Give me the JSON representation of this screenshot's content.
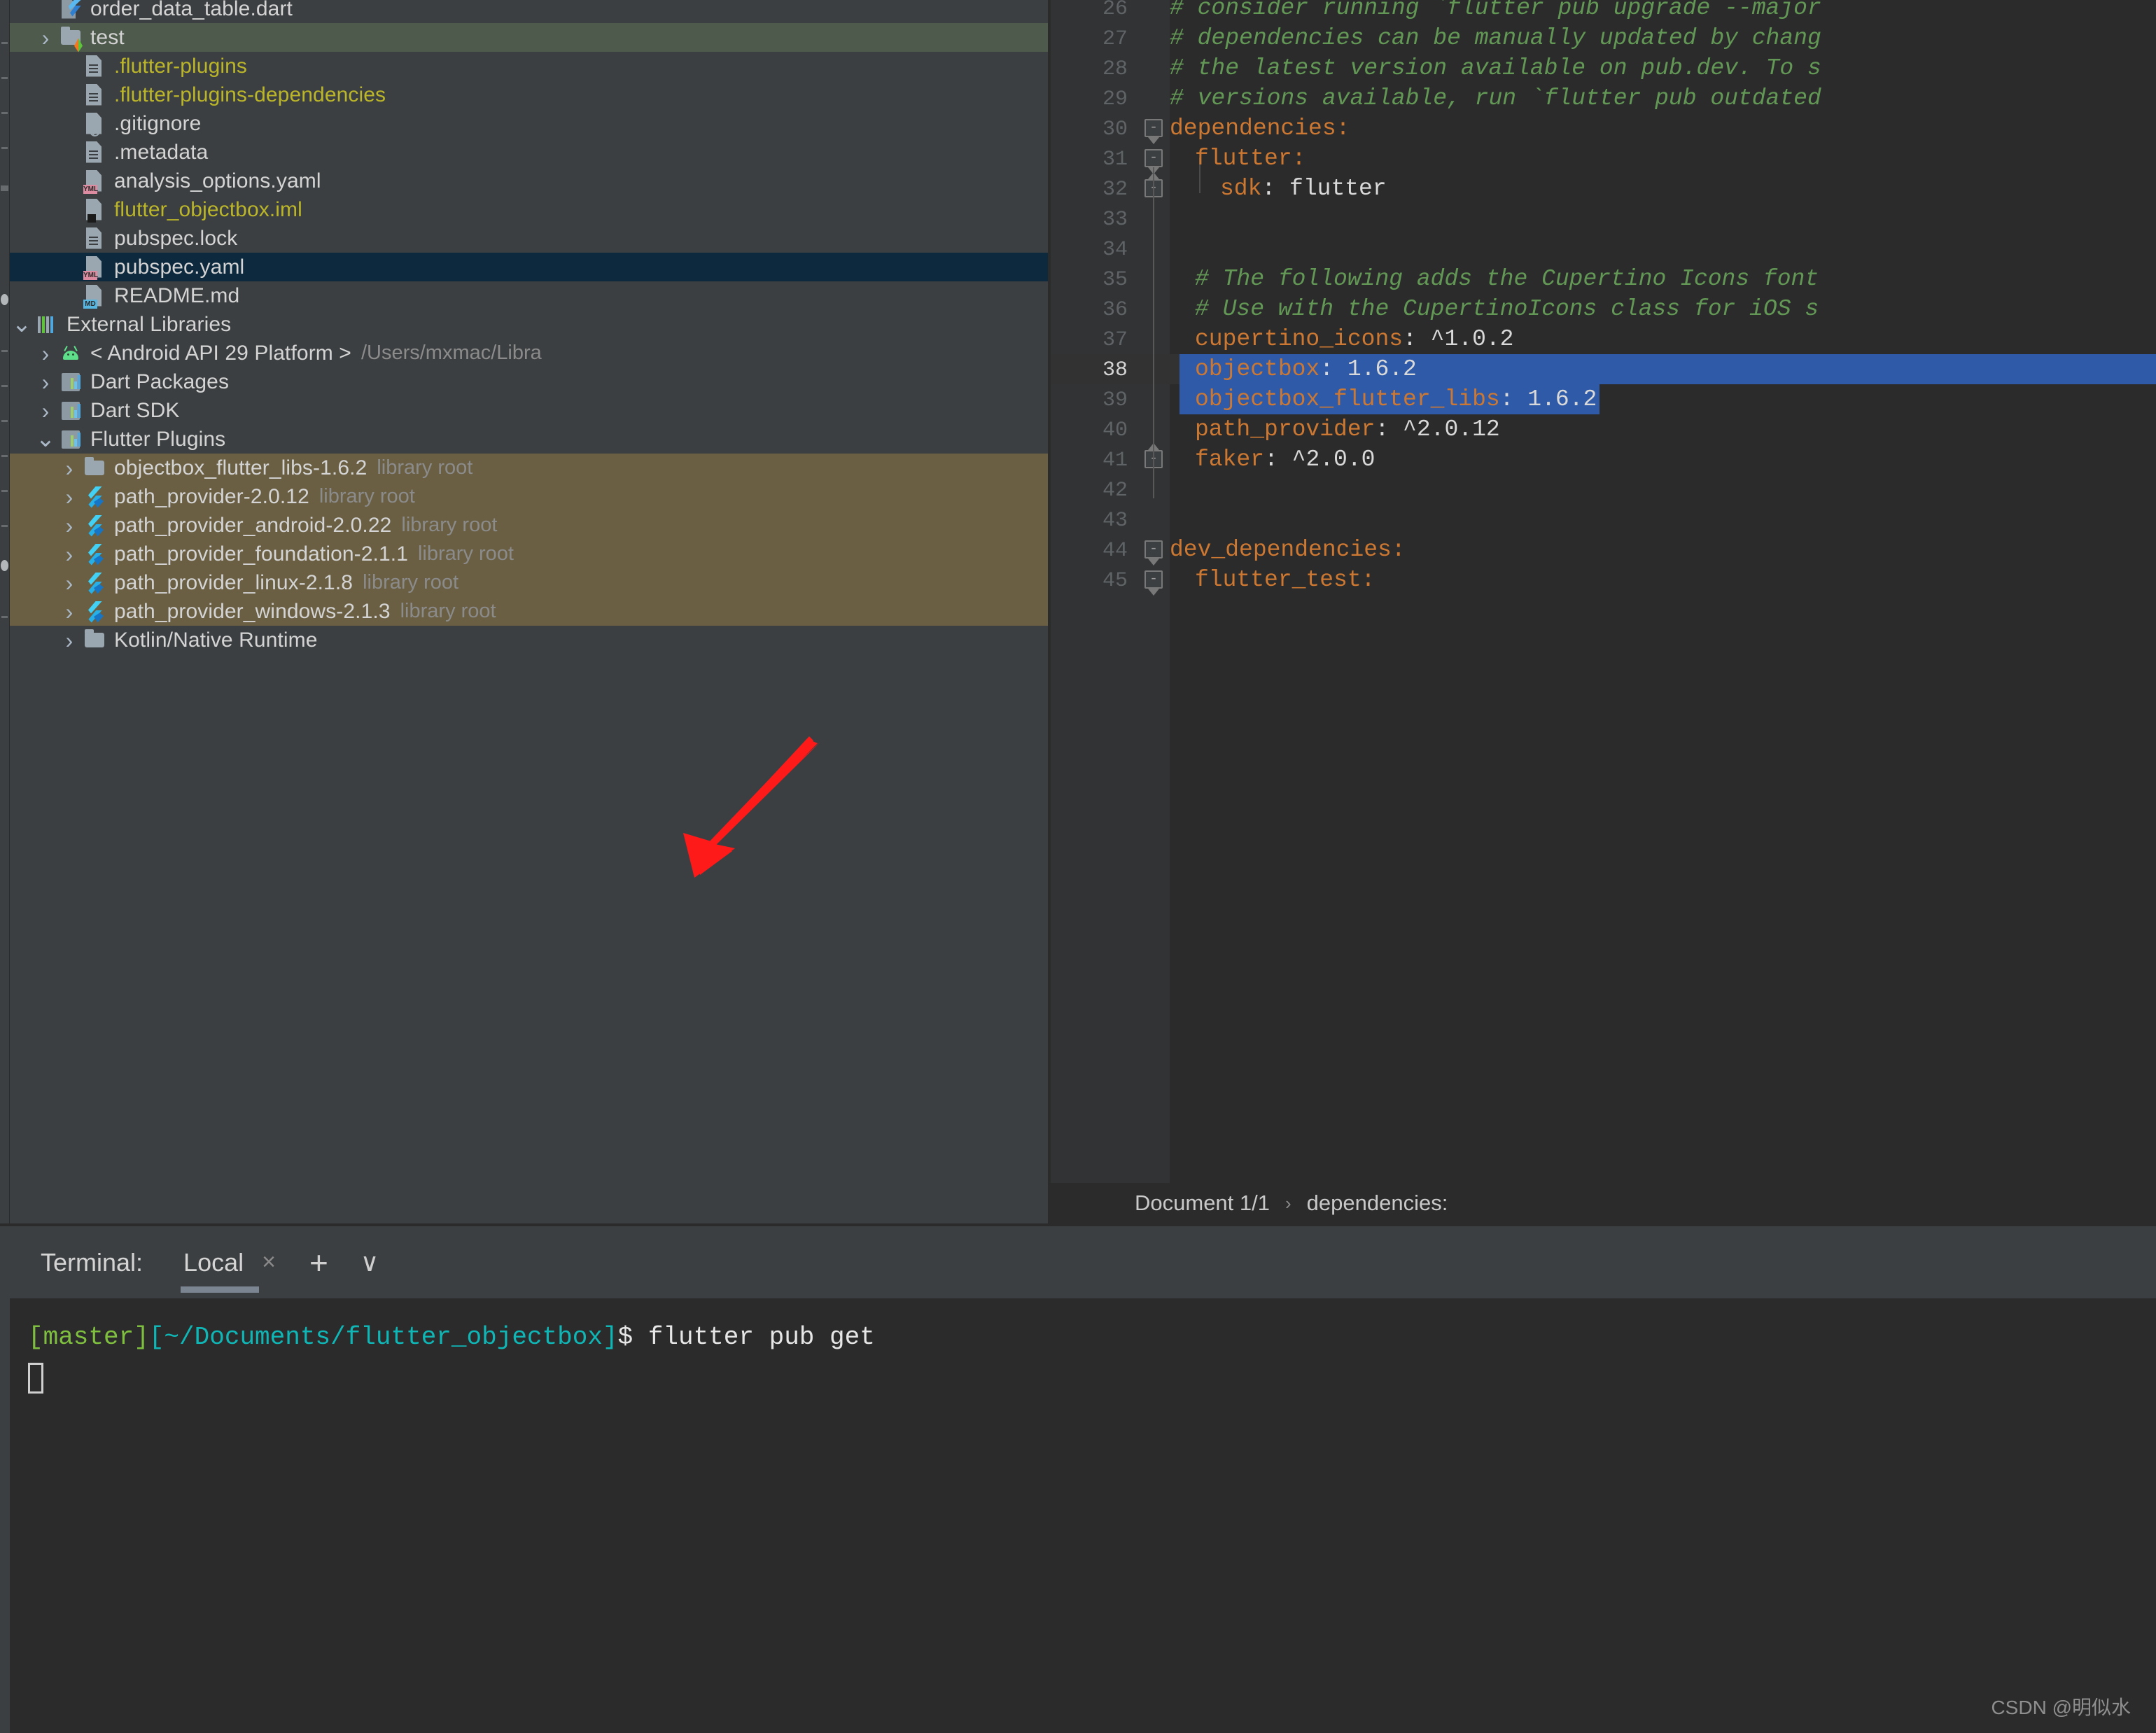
{
  "colors": {
    "panel_bg": "#3c3f41",
    "editor_bg": "#2b2b2b",
    "gutter_bg": "#313335",
    "selection_blue": "#2f5aa8",
    "row_selected_green": "#4e5a4c",
    "row_selected_blue": "#0d293e",
    "row_highlight_tan": "#6a5f43",
    "comment_green": "#629755",
    "keyword_orange": "#cc7832",
    "string_white": "#d9d9d9",
    "yaml_yellow": "#bbb529",
    "arrow_red": "#ff1a1a"
  },
  "project_tree": {
    "rows": [
      {
        "indent": 1,
        "chevron": "",
        "icon": "dart-file-icon",
        "label": "order_data_table.dart",
        "label_color": "white",
        "sub": "",
        "state": "clipped-top"
      },
      {
        "indent": 1,
        "chevron": ">",
        "icon": "folder-flutter-icon",
        "label": "test",
        "label_color": "white",
        "sub": "",
        "state": "selected-green"
      },
      {
        "indent": 2,
        "chevron": "",
        "icon": "file-icon",
        "label": ".flutter-plugins",
        "label_color": "yellow",
        "sub": "",
        "state": ""
      },
      {
        "indent": 2,
        "chevron": "",
        "icon": "file-icon",
        "label": ".flutter-plugins-dependencies",
        "label_color": "yellow",
        "sub": "",
        "state": ""
      },
      {
        "indent": 2,
        "chevron": "",
        "icon": "gitignore-icon",
        "label": ".gitignore",
        "label_color": "white",
        "sub": "",
        "state": ""
      },
      {
        "indent": 2,
        "chevron": "",
        "icon": "file-icon",
        "label": ".metadata",
        "label_color": "white",
        "sub": "",
        "state": ""
      },
      {
        "indent": 2,
        "chevron": "",
        "icon": "yaml-file-icon",
        "label": "analysis_options.yaml",
        "label_color": "white",
        "sub": "",
        "state": ""
      },
      {
        "indent": 2,
        "chevron": "",
        "icon": "iml-file-icon",
        "label": "flutter_objectbox.iml",
        "label_color": "yellow",
        "sub": "",
        "state": ""
      },
      {
        "indent": 2,
        "chevron": "",
        "icon": "file-icon",
        "label": "pubspec.lock",
        "label_color": "white",
        "sub": "",
        "state": ""
      },
      {
        "indent": 2,
        "chevron": "",
        "icon": "yaml-file-icon",
        "label": "pubspec.yaml",
        "label_color": "white",
        "sub": "",
        "state": "selected-blue"
      },
      {
        "indent": 2,
        "chevron": "",
        "icon": "markdown-file-icon",
        "label": "README.md",
        "label_color": "white",
        "sub": "",
        "state": ""
      },
      {
        "indent": 0,
        "chevron": "v",
        "icon": "external-libraries-icon",
        "label": "External Libraries",
        "label_color": "white",
        "sub": "",
        "state": ""
      },
      {
        "indent": 1,
        "chevron": ">",
        "icon": "android-icon",
        "label": "< Android API 29 Platform >",
        "label_color": "white",
        "sub": "/Users/mxmac/Libra",
        "state": ""
      },
      {
        "indent": 1,
        "chevron": ">",
        "icon": "dart-package-icon",
        "label": "Dart Packages",
        "label_color": "white",
        "sub": "",
        "state": ""
      },
      {
        "indent": 1,
        "chevron": ">",
        "icon": "dart-package-icon",
        "label": "Dart SDK",
        "label_color": "white",
        "sub": "",
        "state": ""
      },
      {
        "indent": 1,
        "chevron": "v",
        "icon": "dart-package-icon",
        "label": "Flutter Plugins",
        "label_color": "white",
        "sub": "",
        "state": ""
      },
      {
        "indent": 2,
        "chevron": ">",
        "icon": "folder-icon",
        "label": "objectbox_flutter_libs-1.6.2",
        "label_color": "white",
        "sub": "library root",
        "state": "highlight-tan"
      },
      {
        "indent": 2,
        "chevron": ">",
        "icon": "flutter-icon",
        "label": "path_provider-2.0.12",
        "label_color": "white",
        "sub": "library root",
        "state": "highlight-tan"
      },
      {
        "indent": 2,
        "chevron": ">",
        "icon": "flutter-icon",
        "label": "path_provider_android-2.0.22",
        "label_color": "white",
        "sub": "library root",
        "state": "highlight-tan"
      },
      {
        "indent": 2,
        "chevron": ">",
        "icon": "flutter-icon",
        "label": "path_provider_foundation-2.1.1",
        "label_color": "white",
        "sub": "library root",
        "state": "highlight-tan"
      },
      {
        "indent": 2,
        "chevron": ">",
        "icon": "flutter-icon",
        "label": "path_provider_linux-2.1.8",
        "label_color": "white",
        "sub": "library root",
        "state": "highlight-tan"
      },
      {
        "indent": 2,
        "chevron": ">",
        "icon": "flutter-icon",
        "label": "path_provider_windows-2.1.3",
        "label_color": "white",
        "sub": "library root",
        "state": "highlight-tan"
      },
      {
        "indent": 2,
        "chevron": ">",
        "icon": "folder-icon",
        "label": "Kotlin/Native Runtime",
        "label_color": "white",
        "sub": "",
        "state": "clipped-bottom"
      }
    ]
  },
  "editor": {
    "file": "pubspec.yaml",
    "lines": [
      {
        "num": "26",
        "indent": 0,
        "segments": [
          {
            "t": "# consider running `flutter pub upgrade --major",
            "c": "cm"
          }
        ],
        "fold": "",
        "selected": false,
        "current": false
      },
      {
        "num": "27",
        "indent": 0,
        "segments": [
          {
            "t": "# dependencies can be manually updated by chang",
            "c": "cm"
          }
        ],
        "fold": "",
        "selected": false,
        "current": false
      },
      {
        "num": "28",
        "indent": 0,
        "segments": [
          {
            "t": "# the latest version available on pub.dev. To s",
            "c": "cm"
          }
        ],
        "fold": "",
        "selected": false,
        "current": false
      },
      {
        "num": "29",
        "indent": 0,
        "segments": [
          {
            "t": "# versions available, run `flutter pub outdated",
            "c": "cm"
          }
        ],
        "fold": "",
        "selected": false,
        "current": false
      },
      {
        "num": "30",
        "indent": 0,
        "segments": [
          {
            "t": "dependencies:",
            "c": "key"
          }
        ],
        "fold": "minus-open",
        "selected": false,
        "current": false
      },
      {
        "num": "31",
        "indent": 1,
        "segments": [
          {
            "t": "flutter:",
            "c": "key"
          }
        ],
        "fold": "minus-open",
        "selected": false,
        "current": false
      },
      {
        "num": "32",
        "indent": 2,
        "segments": [
          {
            "t": "sdk",
            "c": "key"
          },
          {
            "t": ": flutter",
            "c": "val"
          }
        ],
        "fold": "minus-end",
        "selected": false,
        "current": false
      },
      {
        "num": "33",
        "indent": 0,
        "segments": [],
        "fold": "",
        "selected": false,
        "current": false
      },
      {
        "num": "34",
        "indent": 0,
        "segments": [],
        "fold": "",
        "selected": false,
        "current": false
      },
      {
        "num": "35",
        "indent": 1,
        "segments": [
          {
            "t": "# The following adds the Cupertino Icons font",
            "c": "cm"
          }
        ],
        "fold": "",
        "selected": false,
        "current": false
      },
      {
        "num": "36",
        "indent": 1,
        "segments": [
          {
            "t": "# Use with the CupertinoIcons class for iOS s",
            "c": "cm"
          }
        ],
        "fold": "",
        "selected": false,
        "current": false
      },
      {
        "num": "37",
        "indent": 1,
        "segments": [
          {
            "t": "cupertino_icons",
            "c": "key"
          },
          {
            "t": ": ^1.0.2",
            "c": "val"
          }
        ],
        "fold": "",
        "selected": false,
        "current": false
      },
      {
        "num": "38",
        "indent": 1,
        "segments": [
          {
            "t": "objectbox",
            "c": "key"
          },
          {
            "t": ": 1.6.2",
            "c": "val"
          }
        ],
        "fold": "",
        "selected": true,
        "current": true
      },
      {
        "num": "39",
        "indent": 1,
        "segments": [
          {
            "t": "objectbox_flutter_libs",
            "c": "key"
          },
          {
            "t": ": 1.6.2",
            "c": "val"
          }
        ],
        "fold": "",
        "selected": true,
        "current": false
      },
      {
        "num": "40",
        "indent": 1,
        "segments": [
          {
            "t": "path_provider",
            "c": "key"
          },
          {
            "t": ": ^2.0.12",
            "c": "val"
          }
        ],
        "fold": "",
        "selected": false,
        "current": false
      },
      {
        "num": "41",
        "indent": 1,
        "segments": [
          {
            "t": "faker",
            "c": "key"
          },
          {
            "t": ": ^2.0.0",
            "c": "val"
          }
        ],
        "fold": "minus-end",
        "selected": false,
        "current": false
      },
      {
        "num": "42",
        "indent": 0,
        "segments": [],
        "fold": "",
        "selected": false,
        "current": false
      },
      {
        "num": "43",
        "indent": 0,
        "segments": [],
        "fold": "",
        "selected": false,
        "current": false
      },
      {
        "num": "44",
        "indent": 0,
        "segments": [
          {
            "t": "dev_dependencies:",
            "c": "key"
          }
        ],
        "fold": "minus-open",
        "selected": false,
        "current": false
      },
      {
        "num": "45",
        "indent": 1,
        "segments": [
          {
            "t": "flutter_test:",
            "c": "key"
          }
        ],
        "fold": "minus-open",
        "selected": false,
        "current": false
      }
    ]
  },
  "breadcrumb": {
    "document": "Document 1/1",
    "separator": "›",
    "node": "dependencies:"
  },
  "terminal": {
    "title": "Terminal:",
    "tab_label": "Local",
    "close_icon": "×",
    "add_icon": "+",
    "chevron_icon": "∨",
    "prompt_branch": "[master]",
    "prompt_path": "[~/Documents/flutter_objectbox]",
    "prompt_dollar": "$",
    "command": " flutter pub get"
  },
  "watermark": "CSDN @明似水"
}
